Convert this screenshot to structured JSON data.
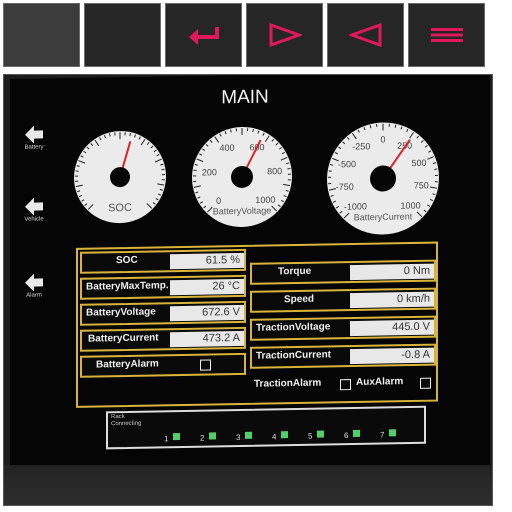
{
  "toolbar": {
    "buttons": [
      {
        "name": "blank-button-1",
        "icon": ""
      },
      {
        "name": "blank-button-2",
        "icon": ""
      },
      {
        "name": "enter-button",
        "icon": "enter-icon"
      },
      {
        "name": "play-forward-button",
        "icon": "play-right-icon"
      },
      {
        "name": "play-back-button",
        "icon": "play-left-icon"
      },
      {
        "name": "menu-button",
        "icon": "menu-icon"
      }
    ],
    "accent_color": "#e0185c"
  },
  "screen": {
    "title": "MAIN",
    "side_nav": [
      {
        "label": "Battery",
        "icon": "arrow-left-icon"
      },
      {
        "label": "Vehicle",
        "icon": "arrow-left-icon"
      },
      {
        "label": "Alarm",
        "icon": "arrow-left-icon"
      }
    ],
    "gauges": [
      {
        "label": "SOC",
        "ticks": [],
        "needle_fraction": 0.56
      },
      {
        "label": "BatteryVoltage",
        "ticks": [
          "0",
          "200",
          "400",
          "600",
          "800",
          "1000"
        ],
        "needle_fraction": 0.6
      },
      {
        "label": "BatteryCurrent",
        "ticks": [
          "-1000",
          "-750",
          "-500",
          "-250",
          "0",
          "250",
          "500",
          "750",
          "1000"
        ],
        "needle_fraction": 0.63
      }
    ],
    "left_fields": [
      {
        "label": "SOC",
        "value": "61.5 %"
      },
      {
        "label": "BatteryMaxTemp.",
        "value": "26 °C"
      },
      {
        "label": "BatteryVoltage",
        "value": "672.6 V"
      },
      {
        "label": "BatteryCurrent",
        "value": "473.2 A"
      },
      {
        "label": "BatteryAlarm",
        "value": ""
      }
    ],
    "right_fields": [
      {
        "label": "Torque",
        "value": "0 Nm"
      },
      {
        "label": "Speed",
        "value": "0 km/h"
      },
      {
        "label": "TractionVoltage",
        "value": "445.0 V"
      },
      {
        "label": "TractionCurrent",
        "value": "-0.8 A"
      }
    ],
    "alarms": {
      "traction": "TractionAlarm",
      "aux": "AuxAlarm"
    },
    "rack": {
      "title_line1": "Rack",
      "title_line2": "Connecting",
      "items": [
        "1",
        "2",
        "3",
        "4",
        "5",
        "6",
        "7"
      ]
    },
    "panel_color": "#d8b43a"
  }
}
